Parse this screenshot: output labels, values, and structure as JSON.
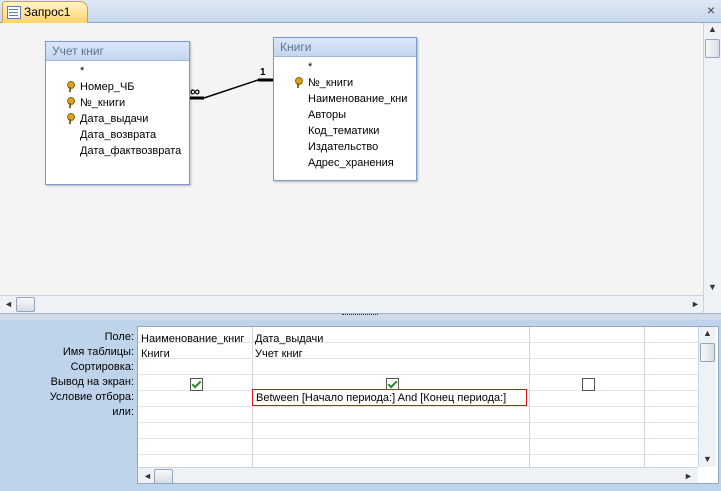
{
  "tab": {
    "label": "Запрос1",
    "close": "×"
  },
  "tables": [
    {
      "title": "Учет книг",
      "fields": [
        {
          "name": "*",
          "key": false
        },
        {
          "name": "Номер_ЧБ",
          "key": true
        },
        {
          "name": "№_книги",
          "key": true
        },
        {
          "name": "Дата_выдачи",
          "key": true
        },
        {
          "name": "Дата_возврата",
          "key": false
        },
        {
          "name": "Дата_фактвозврата",
          "key": false
        }
      ]
    },
    {
      "title": "Книги",
      "fields": [
        {
          "name": "*",
          "key": false
        },
        {
          "name": "№_книги",
          "key": true
        },
        {
          "name": "Наименование_кни",
          "key": false
        },
        {
          "name": "Авторы",
          "key": false
        },
        {
          "name": "Код_тематики",
          "key": false
        },
        {
          "name": "Издательство",
          "key": false
        },
        {
          "name": "Адрес_хранения",
          "key": false
        }
      ]
    }
  ],
  "relationship": {
    "many": "∞",
    "one": "1"
  },
  "design_grid": {
    "row_labels": [
      "Поле:",
      "Имя таблицы:",
      "Сортировка:",
      "Вывод на экран:",
      "Условие отбора:",
      "или:"
    ],
    "columns": [
      {
        "field": "Наименование_книг",
        "table": "Книги",
        "show": true
      },
      {
        "field": "Дата_выдачи",
        "table": "Учет книг",
        "show": true,
        "criteria": "Between [Начало периода:] And [Конец периода:]"
      },
      {
        "field": "",
        "table": "",
        "show": false
      }
    ]
  },
  "scroll": {
    "left": "◄",
    "right": "►",
    "up": "▲",
    "down": "▼"
  }
}
